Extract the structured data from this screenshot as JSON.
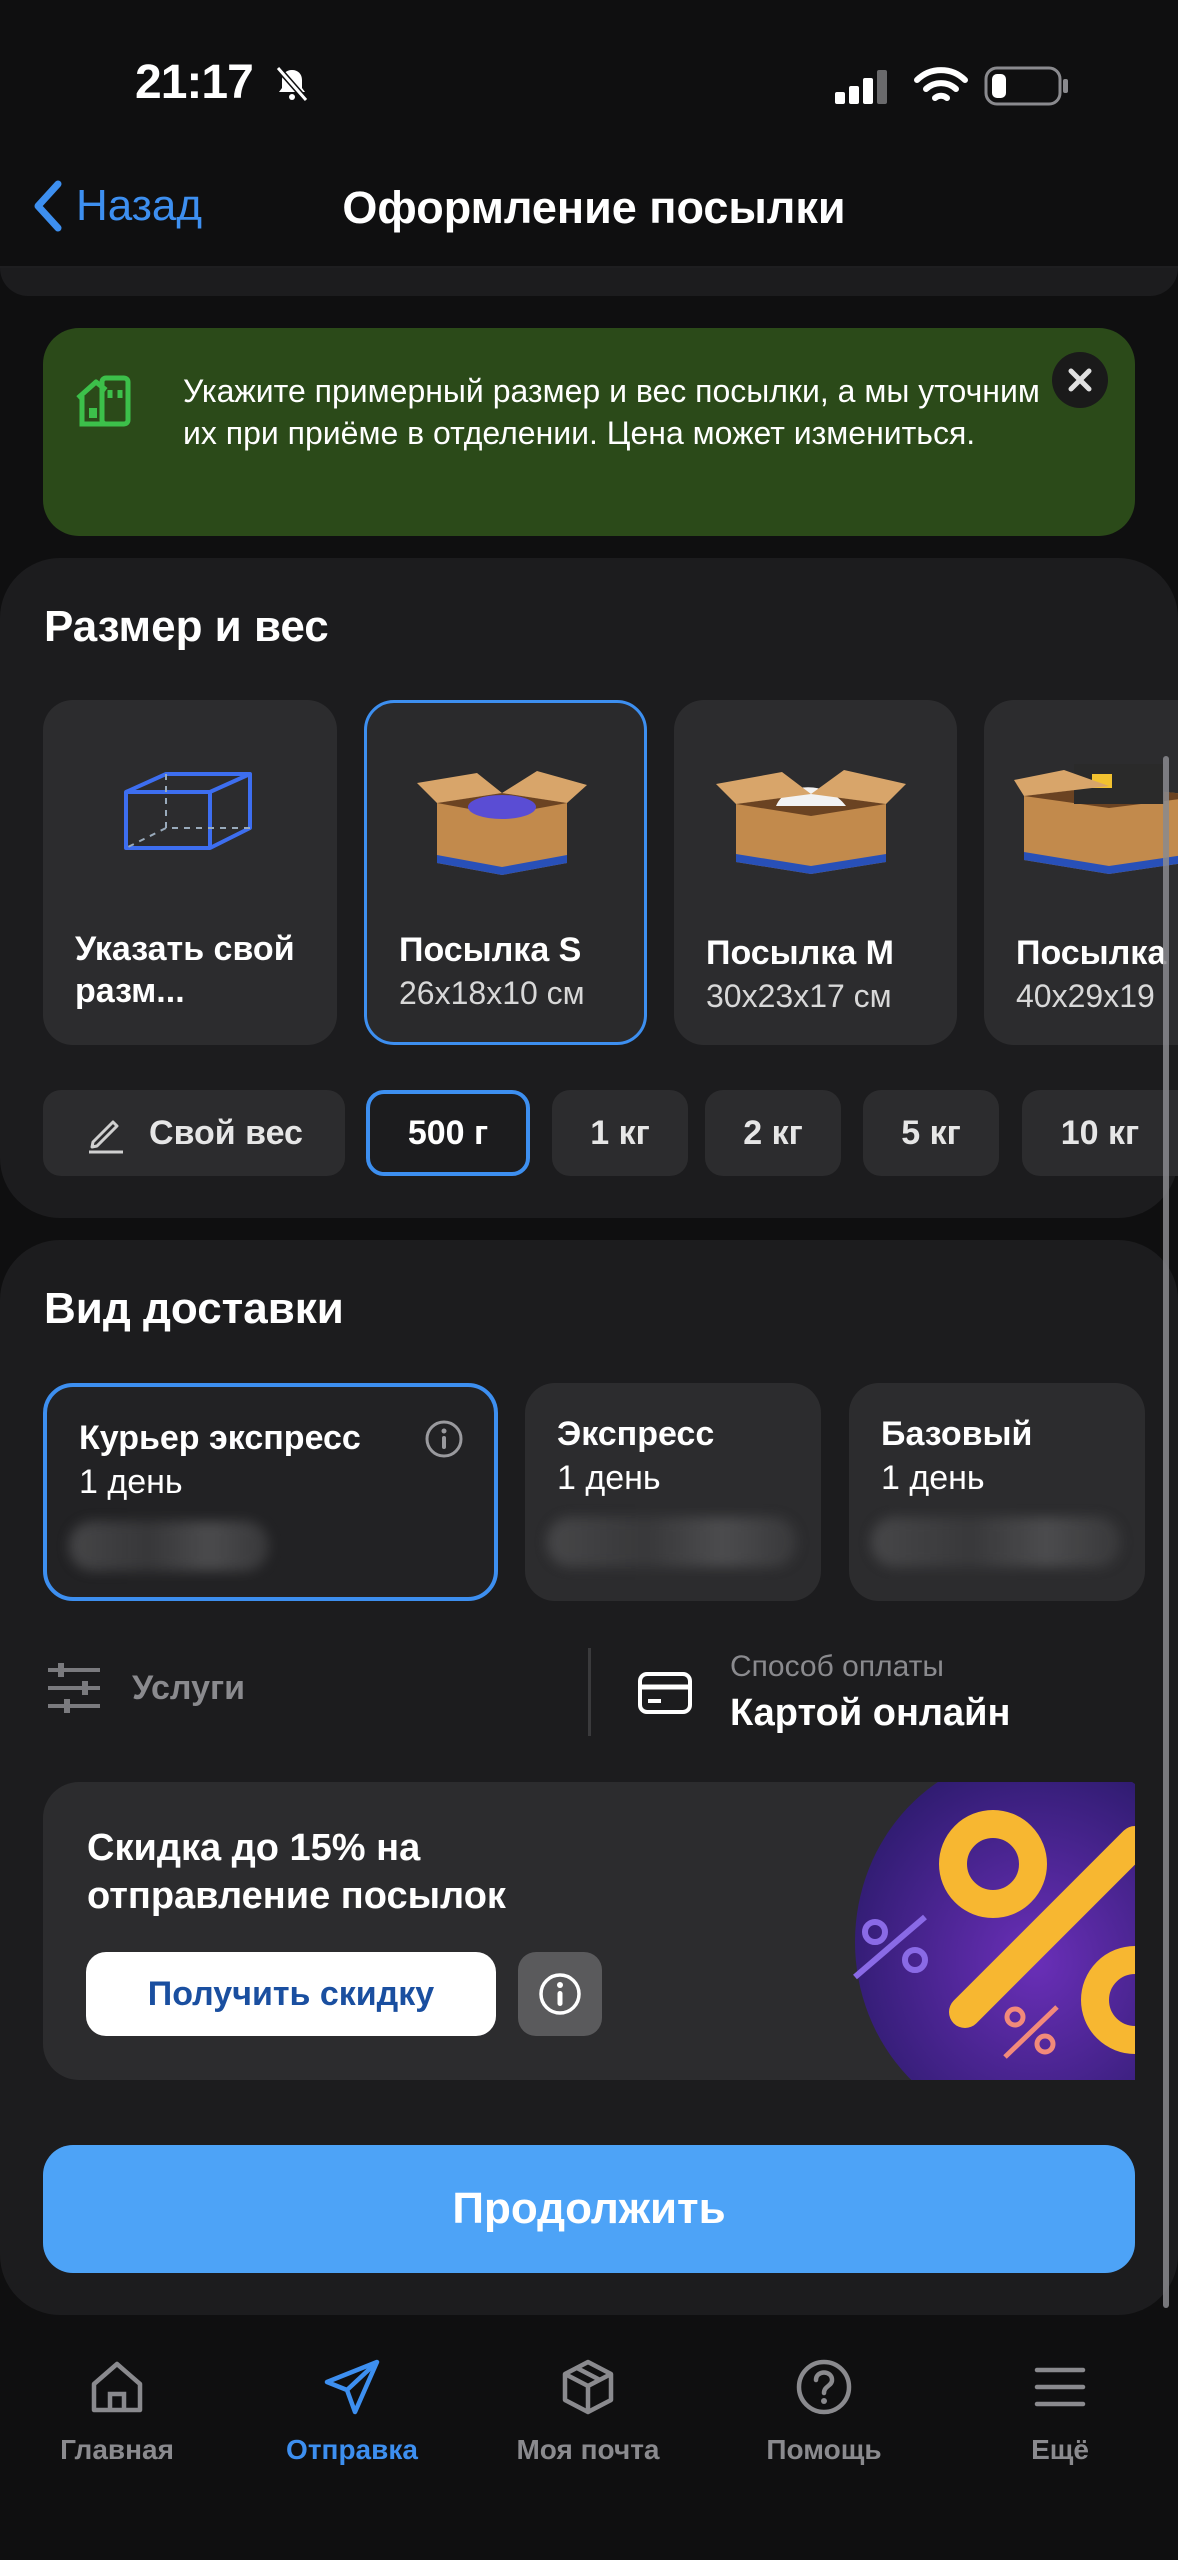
{
  "status_bar": {
    "time": "21:17"
  },
  "header": {
    "back_label": "Назад",
    "title": "Оформление посылки"
  },
  "notice": {
    "text": "Укажите примерный размер и вес посылки, а мы уточним их при приёме в отделении. Цена может измениться."
  },
  "size_section": {
    "title": "Размер и вес",
    "custom_size_label": "Указать свой разм...",
    "packages": [
      {
        "label": "Посылка S",
        "dims": "26x18x10 см",
        "selected": true
      },
      {
        "label": "Посылка M",
        "dims": "30x23x17 см",
        "selected": false
      },
      {
        "label": "Посылка",
        "dims": "40x29x19",
        "selected": false
      }
    ],
    "weights": [
      {
        "label": "Свой вес"
      },
      {
        "label": "500 г",
        "selected": true
      },
      {
        "label": "1 кг"
      },
      {
        "label": "2 кг"
      },
      {
        "label": "5 кг"
      },
      {
        "label": "10 кг"
      }
    ]
  },
  "delivery_section": {
    "title": "Вид доставки",
    "options": [
      {
        "name": "Курьер экспресс",
        "days": "1 день",
        "selected": true
      },
      {
        "name": "Экспресс",
        "days": "1 день",
        "selected": false
      },
      {
        "name": "Базовый",
        "days": "1 день",
        "selected": false
      }
    ],
    "services_label": "Услуги",
    "payment_caption": "Способ оплаты",
    "payment_value": "Картой онлайн"
  },
  "promo": {
    "title": "Скидка до 15% на отправление посылок",
    "button_label": "Получить скидку"
  },
  "continue_label": "Продолжить",
  "tabbar": {
    "items": [
      {
        "label": "Главная",
        "icon": "home-icon"
      },
      {
        "label": "Отправка",
        "icon": "send-icon",
        "active": true
      },
      {
        "label": "Моя почта",
        "icon": "box-icon"
      },
      {
        "label": "Помощь",
        "icon": "help-icon"
      },
      {
        "label": "Ещё",
        "icon": "menu-icon"
      }
    ]
  },
  "colors": {
    "accent": "#3d8ff0",
    "continue_button": "#4da3f7",
    "notice_bg": "#2b4a19",
    "card_bg": "#1c1c1e"
  }
}
